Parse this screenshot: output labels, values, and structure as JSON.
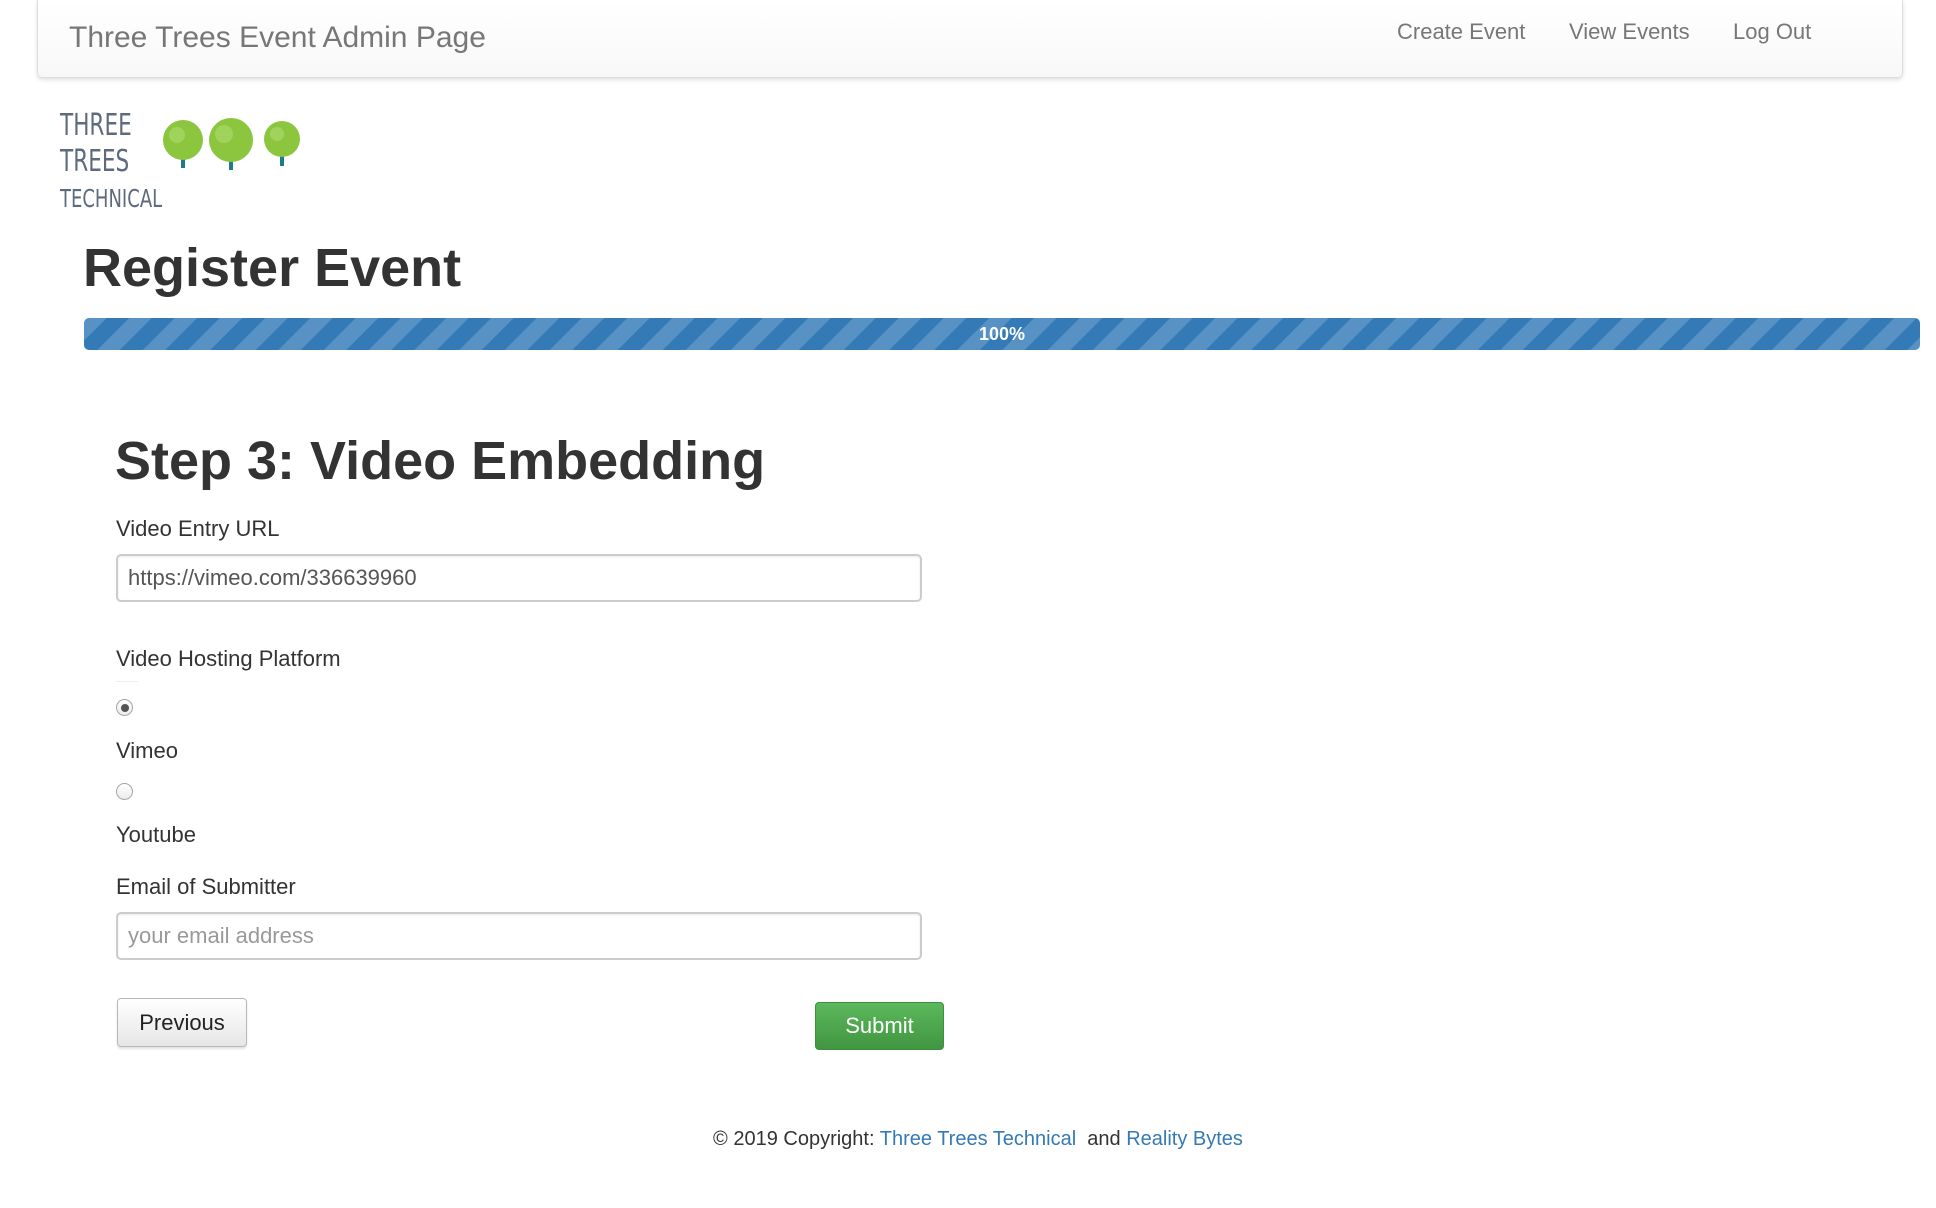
{
  "navbar": {
    "brand": "Three Trees Event Admin Page",
    "links": [
      {
        "label": "Create Event"
      },
      {
        "label": "View Events"
      },
      {
        "label": "Log Out"
      }
    ]
  },
  "logo": {
    "line1": "THREE",
    "line2": "TREES",
    "line3": "TECHNICAL",
    "colors": {
      "text": "#5d6b7c",
      "leaves": "#8cc63f",
      "trunk": "#1f7a8c"
    }
  },
  "page_title": "Register Event",
  "progress": {
    "value": 1.0,
    "label": "100%",
    "color": "#337ab7"
  },
  "form": {
    "step_title": "Step 3: Video Embedding",
    "video_url": {
      "label": "Video Entry URL",
      "value": "https://vimeo.com/336639960"
    },
    "platform": {
      "label": "Video Hosting Platform",
      "options": [
        {
          "label": "Vimeo",
          "selected": true
        },
        {
          "label": "Youtube",
          "selected": false
        }
      ]
    },
    "email": {
      "label": "Email of Submitter",
      "value": "",
      "placeholder": "your email address"
    },
    "previous_label": "Previous",
    "submit_label": "Submit",
    "submit_color": "#5cb85c"
  },
  "footer": {
    "prefix": "© 2019 Copyright: ",
    "link1": "Three Trees Technical",
    "joiner": "and",
    "link2": "Reality Bytes",
    "link_color": "#337ab7"
  }
}
